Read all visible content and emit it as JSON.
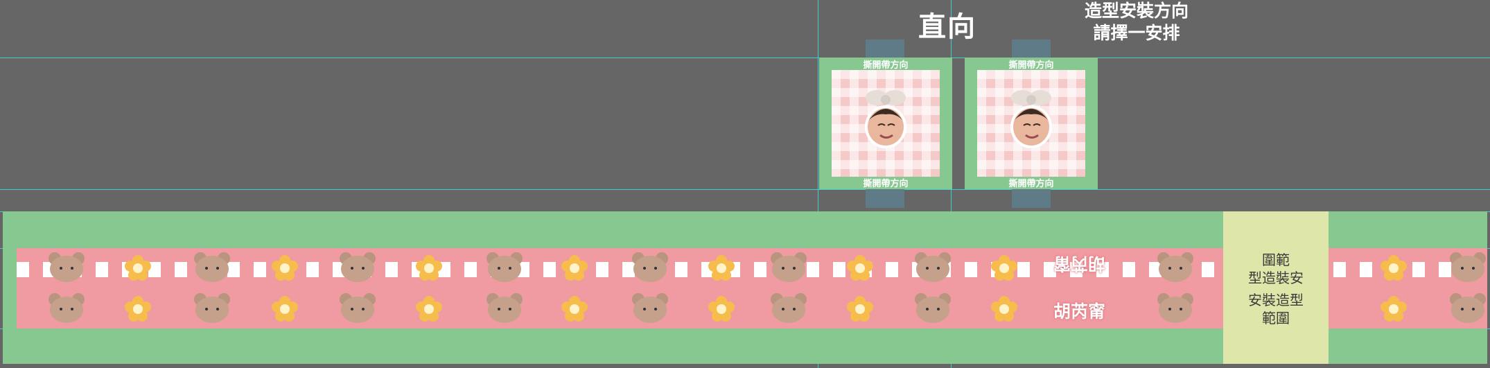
{
  "header": {
    "title": "直向",
    "note_line1": "造型安裝方向",
    "note_line2": "請擇一安排"
  },
  "stickers": [
    {
      "top_label": "撕開帶方向",
      "bottom_label": "撕開帶方向"
    },
    {
      "top_label": "撕開帶方向",
      "bottom_label": "撕開帶方向"
    }
  ],
  "tape": {
    "name_top": "胡芮甯",
    "name_bottom": "胡芮甯"
  },
  "notice": {
    "top_line1": "圍範",
    "top_line2": "型造裝安",
    "bottom_line1": "安裝造型",
    "bottom_line2": "範圍"
  },
  "colors": {
    "background": "#666666",
    "green": "#87c790",
    "pink": "#f09aa1",
    "panel": "#dfe6a9",
    "guide": "#35e0e0"
  }
}
